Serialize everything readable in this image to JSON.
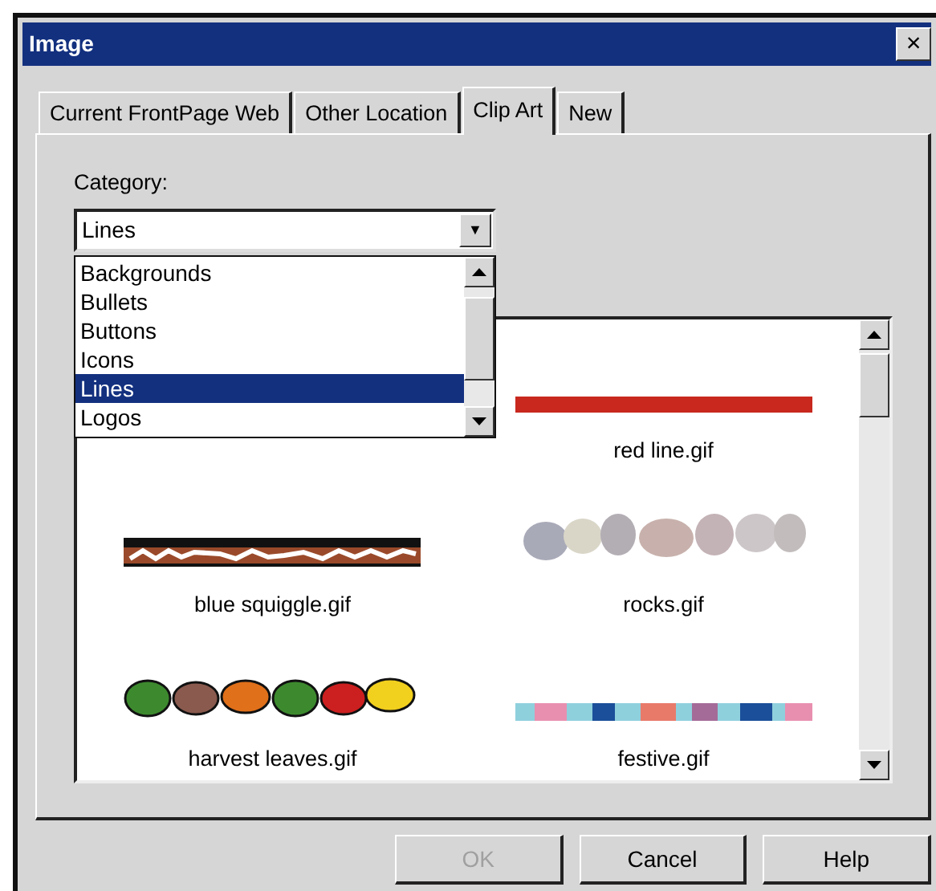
{
  "window": {
    "title": "Image",
    "close": "×"
  },
  "tabs": [
    {
      "label": "Current FrontPage Web",
      "selected": false
    },
    {
      "label": "Other Location",
      "selected": false
    },
    {
      "label": "Clip Art",
      "selected": true
    },
    {
      "label": "New",
      "selected": false
    }
  ],
  "category": {
    "label": "Category:",
    "value": "Lines",
    "arrow": "▼",
    "options": [
      {
        "label": "Backgrounds",
        "selected": false
      },
      {
        "label": "Bullets",
        "selected": false
      },
      {
        "label": "Buttons",
        "selected": false
      },
      {
        "label": "Icons",
        "selected": false
      },
      {
        "label": "Lines",
        "selected": true
      },
      {
        "label": "Logos",
        "selected": false
      }
    ]
  },
  "clips": [
    {
      "name": "red line.gif"
    },
    {
      "name": "blue squiggle.gif"
    },
    {
      "name": "rocks.gif"
    },
    {
      "name": "harvest leaves.gif"
    },
    {
      "name": "festive.gif"
    }
  ],
  "buttons": [
    {
      "label": "OK",
      "disabled": true
    },
    {
      "label": "Cancel",
      "disabled": false
    },
    {
      "label": "Help",
      "disabled": false
    }
  ]
}
